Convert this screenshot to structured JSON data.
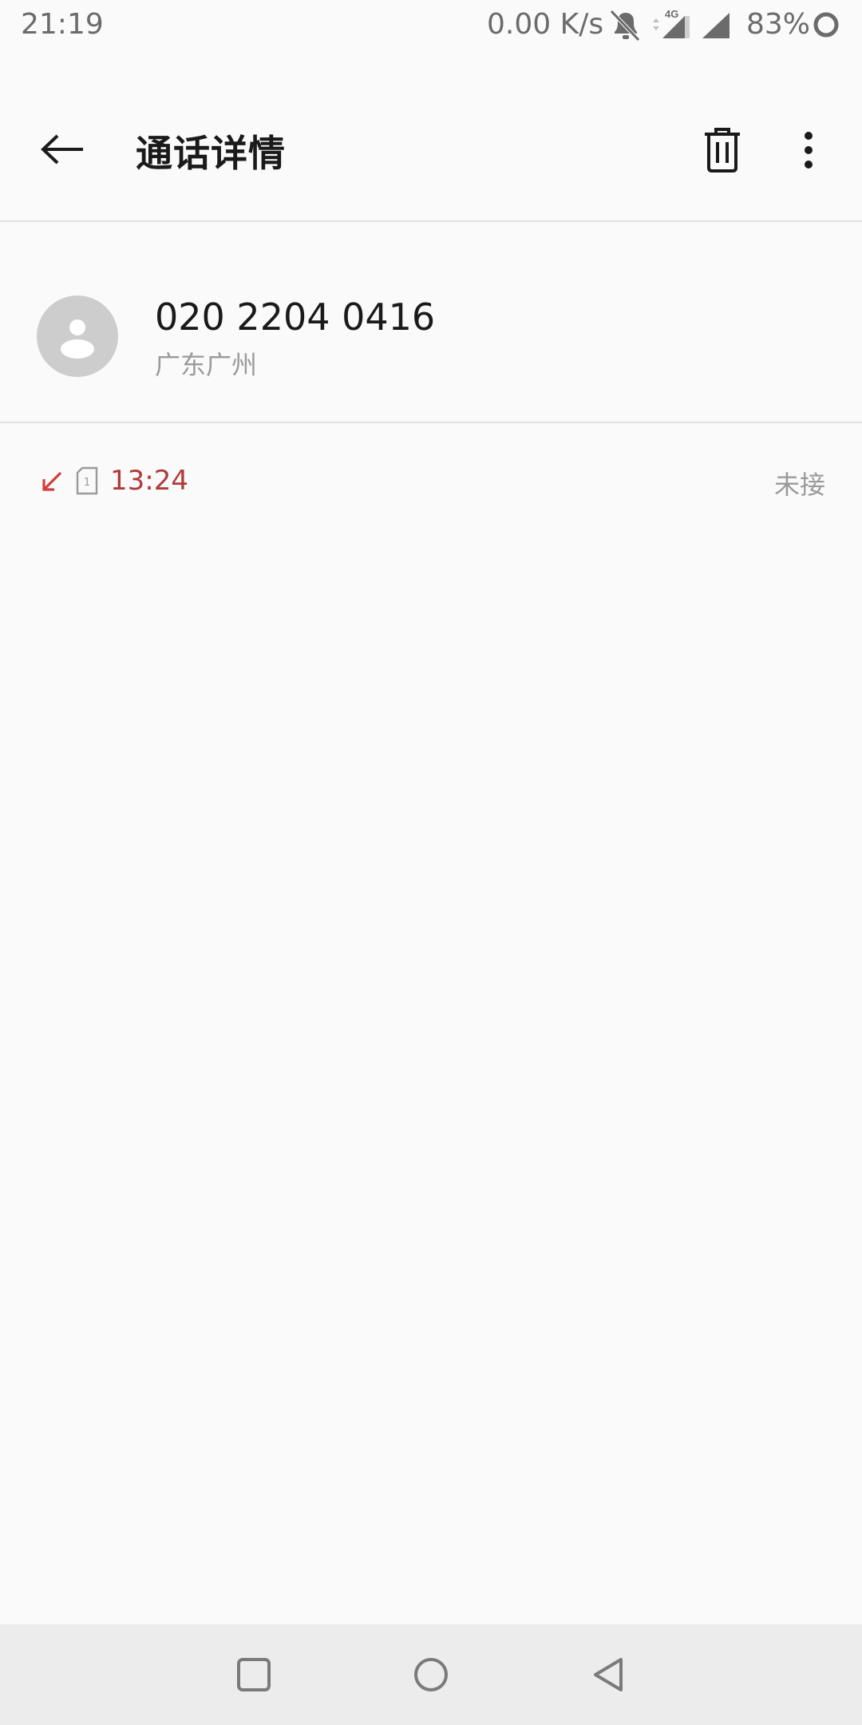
{
  "status_bar": {
    "time": "21:19",
    "network_speed": "0.00 K/s",
    "network_type": "4G",
    "battery": "83%",
    "icons": [
      "bell-off-icon",
      "signal-4g-icon",
      "signal-icon",
      "battery-ring-icon"
    ]
  },
  "app_bar": {
    "title": "通话详情",
    "back_icon": "arrow-left-icon",
    "delete_icon": "trash-icon",
    "more_icon": "more-vert-icon"
  },
  "contact": {
    "number": "020 2204 0416",
    "location": "广东广州",
    "avatar_icon": "person-icon"
  },
  "call_records": [
    {
      "direction_icon": "missed-call-icon",
      "sim_slot": "1",
      "time": "13:24",
      "status": "未接"
    }
  ],
  "colors": {
    "missed": "#b13a3a",
    "missed_arrow": "#d43c3c",
    "background": "#fafafa",
    "nav_bar": "#ececec"
  },
  "nav_bar": {
    "icons": [
      "recents-icon",
      "home-icon",
      "back-icon"
    ]
  }
}
